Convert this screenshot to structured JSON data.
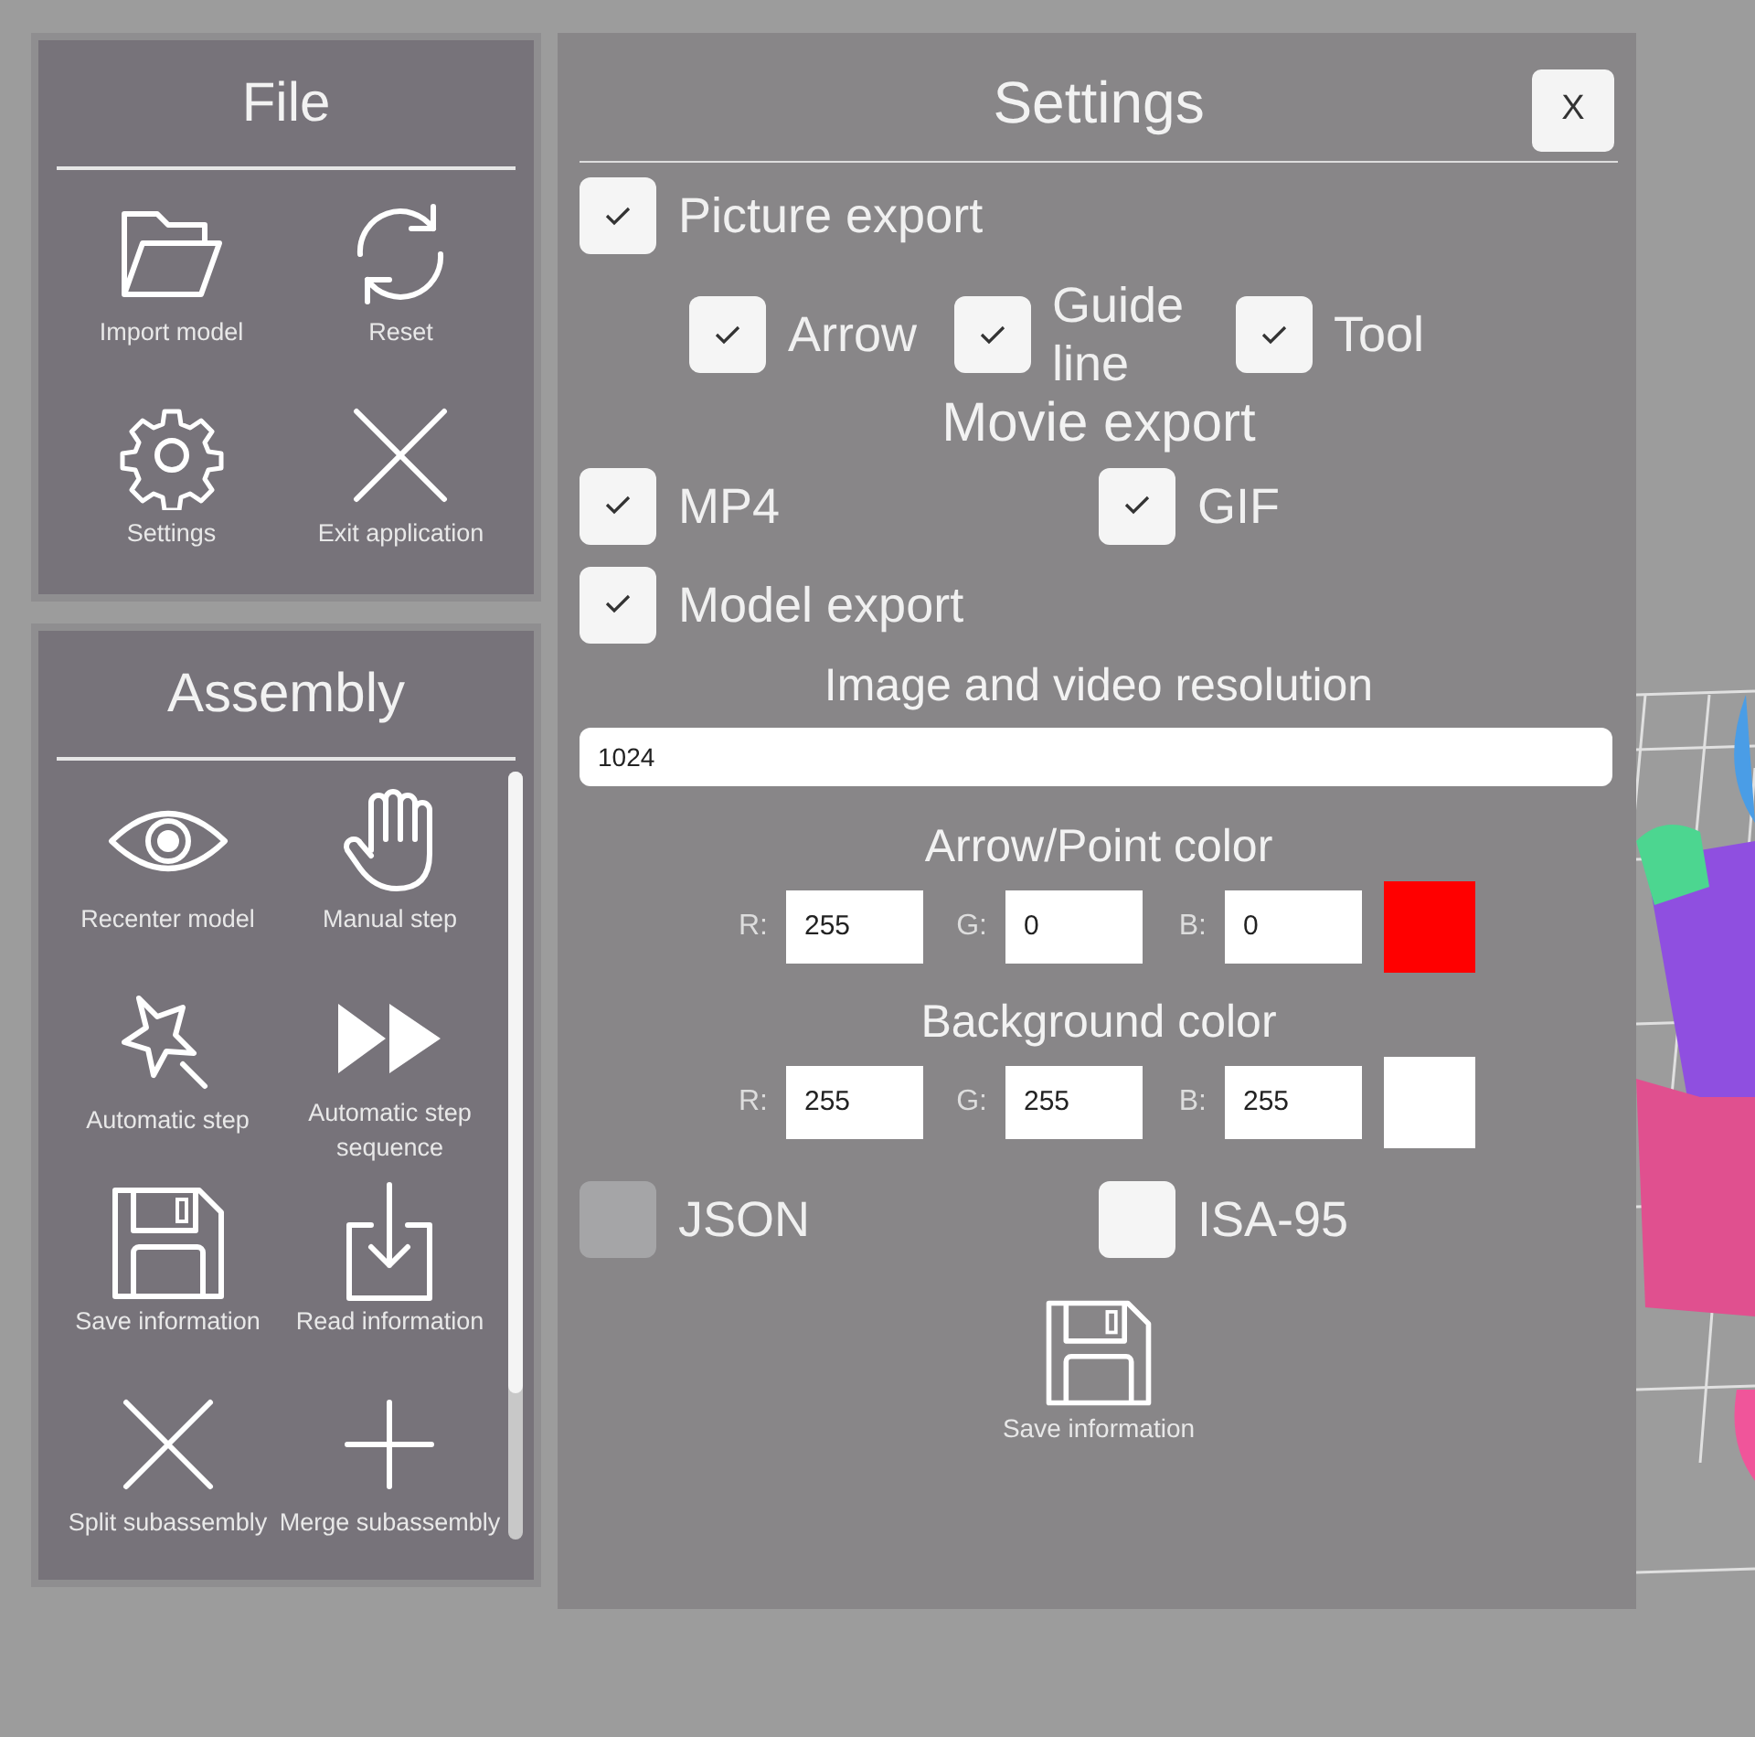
{
  "file_panel": {
    "title": "File",
    "items": [
      {
        "label": "Import model"
      },
      {
        "label": "Reset"
      },
      {
        "label": "Settings"
      },
      {
        "label": "Exit application"
      }
    ]
  },
  "assembly_panel": {
    "title": "Assembly",
    "items": [
      {
        "label": "Recenter model"
      },
      {
        "label": "Manual step"
      },
      {
        "label": "Automatic step"
      },
      {
        "label": "Automatic step sequence"
      },
      {
        "label": "Save information"
      },
      {
        "label": "Read information"
      },
      {
        "label": "Split subassembly"
      },
      {
        "label": "Merge subassembly"
      }
    ]
  },
  "settings": {
    "title": "Settings",
    "close": "X",
    "picture_export": {
      "label": "Picture export",
      "checked": true
    },
    "picture_options": [
      {
        "label": "Arrow",
        "checked": true
      },
      {
        "label": "Guide line",
        "checked": true
      },
      {
        "label": "Tool",
        "checked": true
      }
    ],
    "movie_heading": "Movie export",
    "movie_options": [
      {
        "label": "MP4",
        "checked": true
      },
      {
        "label": "GIF",
        "checked": true
      }
    ],
    "model_export": {
      "label": "Model export",
      "checked": true
    },
    "resolution": {
      "label": "Image and video resolution",
      "value": "1024"
    },
    "colors": [
      {
        "label": "Arrow/Point color",
        "channels": [
          {
            "label": "R:",
            "value": "255"
          },
          {
            "label": "G:",
            "value": "0"
          },
          {
            "label": "B:",
            "value": "0"
          }
        ]
      },
      {
        "label": "Background color",
        "channels": [
          {
            "label": "R:",
            "value": "255"
          },
          {
            "label": "G:",
            "value": "255"
          },
          {
            "label": "B:",
            "value": "255"
          }
        ]
      }
    ],
    "format_options": [
      {
        "label": "JSON",
        "checked": false,
        "disabled": true
      },
      {
        "label": "ISA-95",
        "checked": false,
        "disabled": false
      }
    ],
    "save_button": {
      "label": "Save information"
    }
  }
}
